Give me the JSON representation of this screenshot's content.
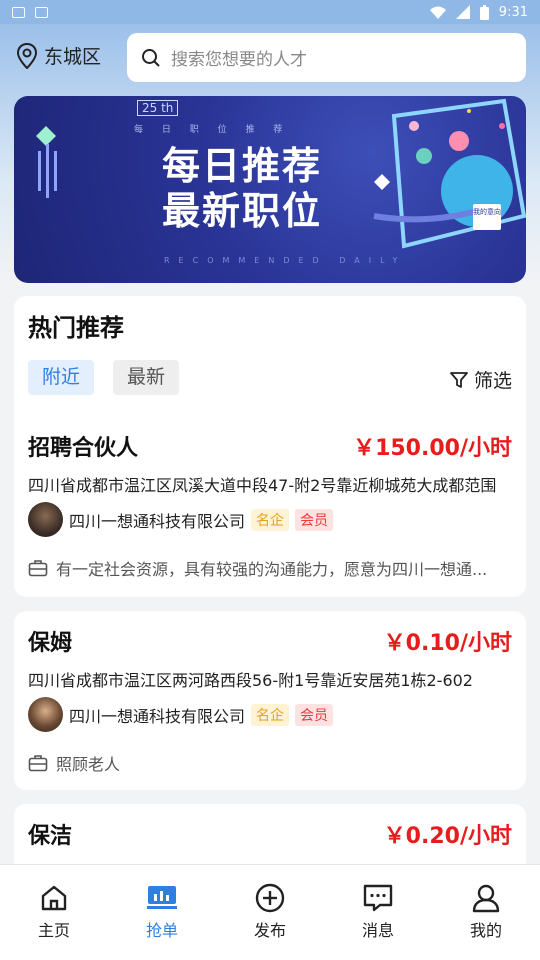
{
  "status_bar": {
    "time": "9:31"
  },
  "header": {
    "location": "东城区",
    "search_placeholder": "搜索您想要的人才"
  },
  "banner": {
    "badge": "25 th",
    "subtitle": "每 日 职 位 推 荐",
    "title_line1": "每日推荐",
    "title_line2": "最新职位",
    "footer": "RECOMMENDED DAILY",
    "tag": "我的意向"
  },
  "hot": {
    "title": "热门推荐",
    "tabs": [
      "附近",
      "最新"
    ],
    "filter_label": "筛选"
  },
  "jobs": [
    {
      "title": "招聘合伙人",
      "price": "￥150.00/小时",
      "address": "四川省成都市温江区凤溪大道中段47-附2号靠近柳城苑大成都范围",
      "company": "四川一想通科技有限公司",
      "tag_famous": "名企",
      "tag_vip": "会员",
      "desc": "有一定社会资源，具有较强的沟通能力，愿意为四川一想通..."
    },
    {
      "title": "保姆",
      "price": "￥0.10/小时",
      "address": "四川省成都市温江区两河路西段56-附1号靠近安居苑1栋2-602",
      "company": "四川一想通科技有限公司",
      "tag_famous": "名企",
      "tag_vip": "会员",
      "desc": "照顾老人"
    },
    {
      "title": "保洁",
      "price": "￥0.20/小时"
    }
  ],
  "tabbar": [
    "主页",
    "抢单",
    "发布",
    "消息",
    "我的"
  ],
  "colors": {
    "accent": "#2f7fe0",
    "price": "#e81c1c",
    "famous": "#e9a21f",
    "vip": "#e83b3b"
  }
}
